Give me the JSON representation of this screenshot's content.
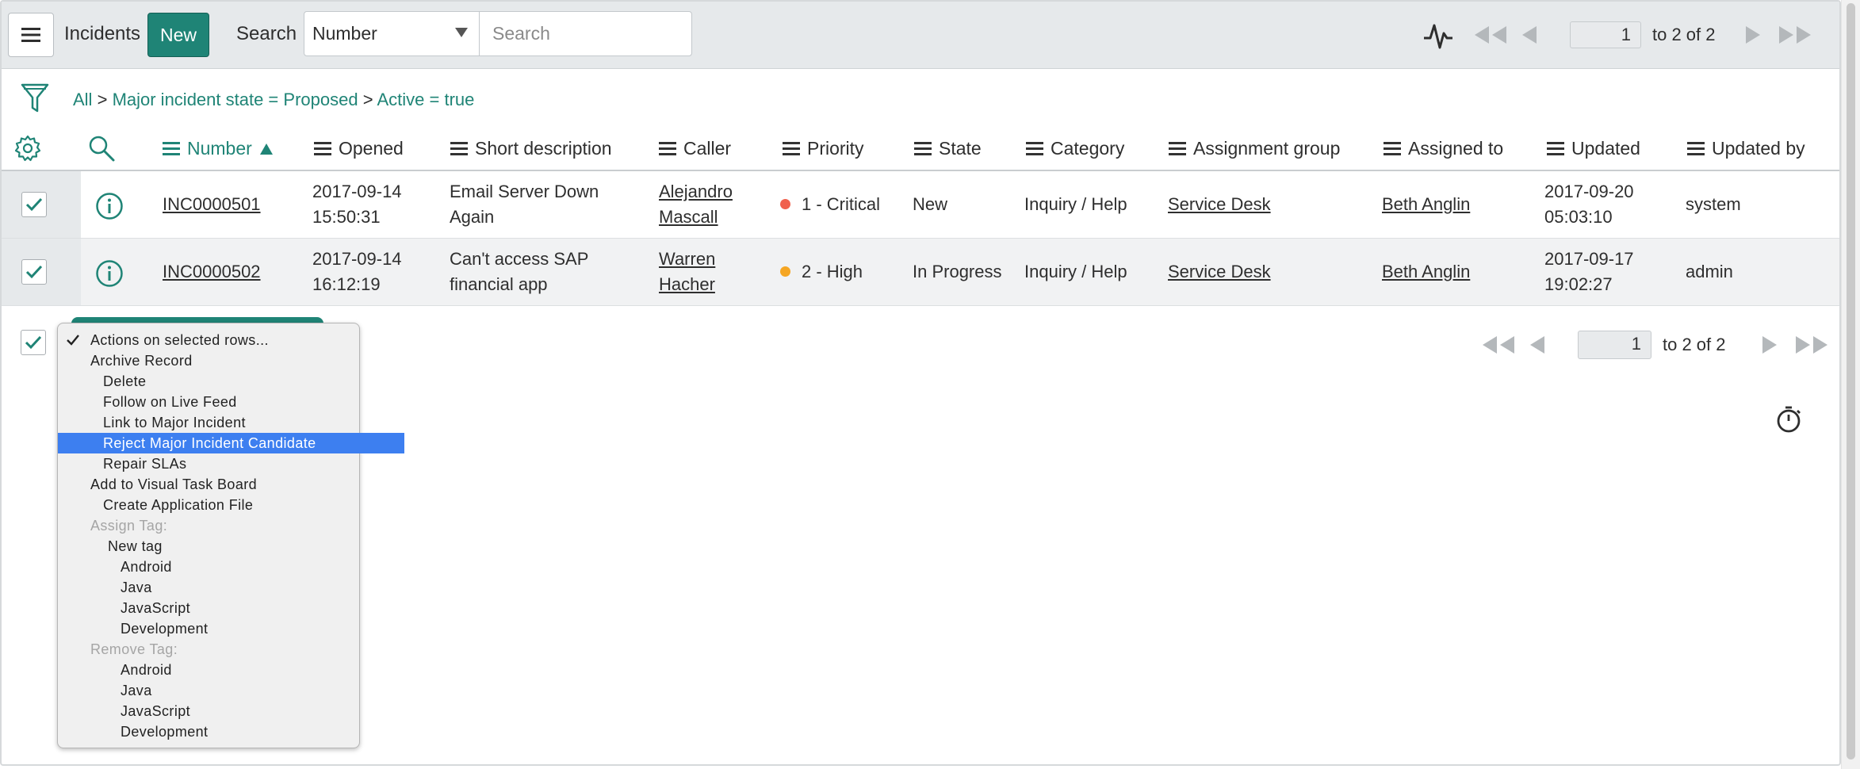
{
  "header": {
    "title": "Incidents",
    "new_label": "New",
    "search_label": "Search",
    "search_field": "Number",
    "search_placeholder": "Search",
    "page": "1",
    "range": "to 2 of 2"
  },
  "breadcrumb": {
    "all": "All",
    "sep1": ">",
    "crumb1": "Major incident state = Proposed",
    "sep2": ">",
    "crumb2": "Active = true"
  },
  "columns": [
    "Number",
    "Opened",
    "Short description",
    "Caller",
    "Priority",
    "State",
    "Category",
    "Assignment group",
    "Assigned to",
    "Updated",
    "Updated by"
  ],
  "rows": [
    {
      "number": "INC0000501",
      "opened_date": "2017-09-14",
      "opened_time": "15:50:31",
      "desc1": "Email Server Down",
      "desc2": "Again",
      "caller1": "Alejandro",
      "caller2": "Mascall",
      "priority": "1 - Critical",
      "priority_color": "#f0604d",
      "state": "New",
      "category": "Inquiry / Help",
      "group": "Service Desk",
      "assigned": "Beth Anglin",
      "updated_date": "2017-09-20",
      "updated_time": "05:03:10",
      "updated_by": "system"
    },
    {
      "number": "INC0000502",
      "opened_date": "2017-09-14",
      "opened_time": "16:12:19",
      "desc1": "Can't access SAP",
      "desc2": "financial app",
      "caller1": "Warren",
      "caller2": "Hacher",
      "priority": "2 - High",
      "priority_color": "#f5a623",
      "state": "In Progress",
      "category": "Inquiry / Help",
      "group": "Service Desk",
      "assigned": "Beth Anglin",
      "updated_date": "2017-09-17",
      "updated_time": "19:02:27",
      "updated_by": "admin"
    }
  ],
  "footer": {
    "page": "1",
    "range": "to 2 of 2"
  },
  "actions_menu": [
    {
      "label": "Actions on selected rows...",
      "checked": true
    },
    {
      "label": "Archive Record"
    },
    {
      "label": "Delete"
    },
    {
      "label": "Follow on Live Feed"
    },
    {
      "label": "Link to Major Incident"
    },
    {
      "label": "Reject Major Incident Candidate",
      "selected": true
    },
    {
      "label": "Repair SLAs"
    },
    {
      "label": "Add to Visual Task Board"
    },
    {
      "label": "Create Application File"
    },
    {
      "label": "Assign Tag:",
      "disabled": true
    },
    {
      "label": "New tag"
    },
    {
      "label": "Android"
    },
    {
      "label": "Java"
    },
    {
      "label": "JavaScript"
    },
    {
      "label": "Development"
    },
    {
      "label": "Remove Tag:",
      "disabled": true
    },
    {
      "label": "Android"
    },
    {
      "label": "Java"
    },
    {
      "label": "JavaScript"
    },
    {
      "label": "Development"
    }
  ],
  "colors": {
    "accent": "#1f8476",
    "selection": "#3d7ff0"
  }
}
